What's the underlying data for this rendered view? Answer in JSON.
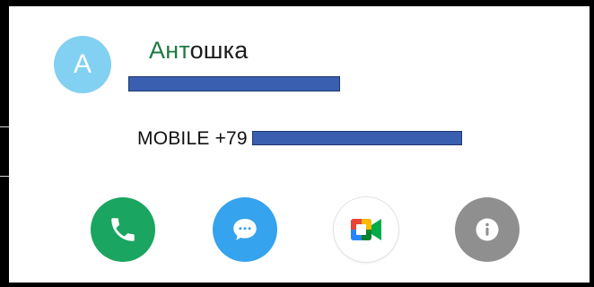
{
  "contact": {
    "avatar_letter": "A",
    "name_highlight": "Ант",
    "name_rest": "ошка",
    "phone_label": "MOBILE +79"
  },
  "actions": [
    {
      "id": "call",
      "icon": "phone-icon",
      "color": "#1aa561"
    },
    {
      "id": "message",
      "icon": "message-bubble-icon",
      "color": "#35a3ee"
    },
    {
      "id": "video",
      "icon": "google-meet-icon",
      "color": "#ffffff"
    },
    {
      "id": "info",
      "icon": "info-icon",
      "color": "#8f8f8f"
    }
  ],
  "colors": {
    "accent_name": "#1f7a43",
    "redaction": "#3a5fb0"
  }
}
